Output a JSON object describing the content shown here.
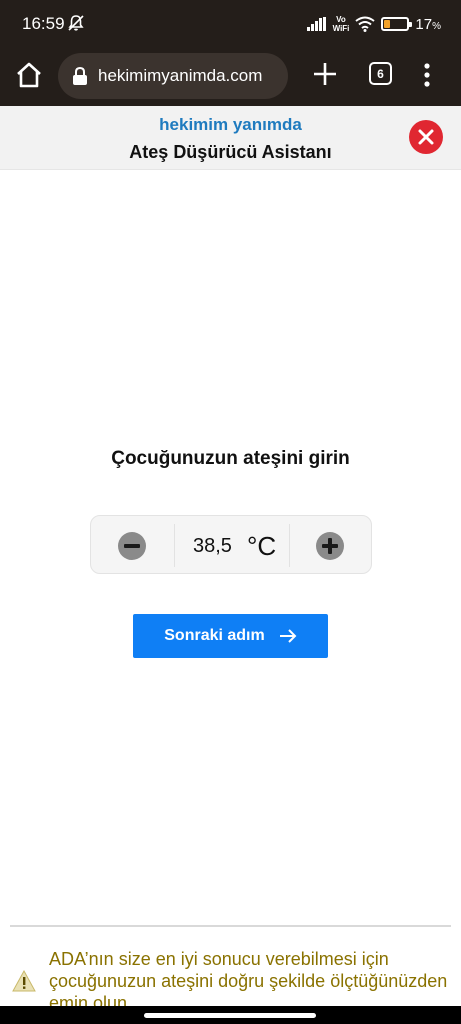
{
  "status_bar": {
    "time": "16:59",
    "volte_line1": "Vo",
    "volte_line2": "WiFi",
    "battery_percent": "17",
    "battery_level": 0.17,
    "icons": [
      "mute-icon",
      "signal-icon",
      "wifi-icon",
      "battery-icon"
    ]
  },
  "browser": {
    "url": "hekimimyanimda.com",
    "tab_count": "6",
    "icons": [
      "home-icon",
      "lock-icon",
      "plus-icon",
      "tabs-icon",
      "more-vert-icon"
    ]
  },
  "header": {
    "brand": "hekimim yanımda",
    "title": "Ateş Düşürücü Asistanı",
    "close_icon": "close-icon",
    "close_color": "#e02731",
    "brand_color": "#1f7bbf"
  },
  "main": {
    "question": "Çocuğunuzun ateşini girin",
    "temperature": "38,5",
    "unit": "°C",
    "next_label": "Sonraki adım",
    "next_icon": "arrow-right-icon",
    "accent_color": "#0f7ff5"
  },
  "footer": {
    "warning_icon": "warning-icon",
    "warning_text": "ADA’nın size en iyi sonucu verebilmesi için çocuğunuzun ateşini doğru şekilde ölçtüğünüzden emin olun",
    "warning_color": "#8a7200"
  }
}
